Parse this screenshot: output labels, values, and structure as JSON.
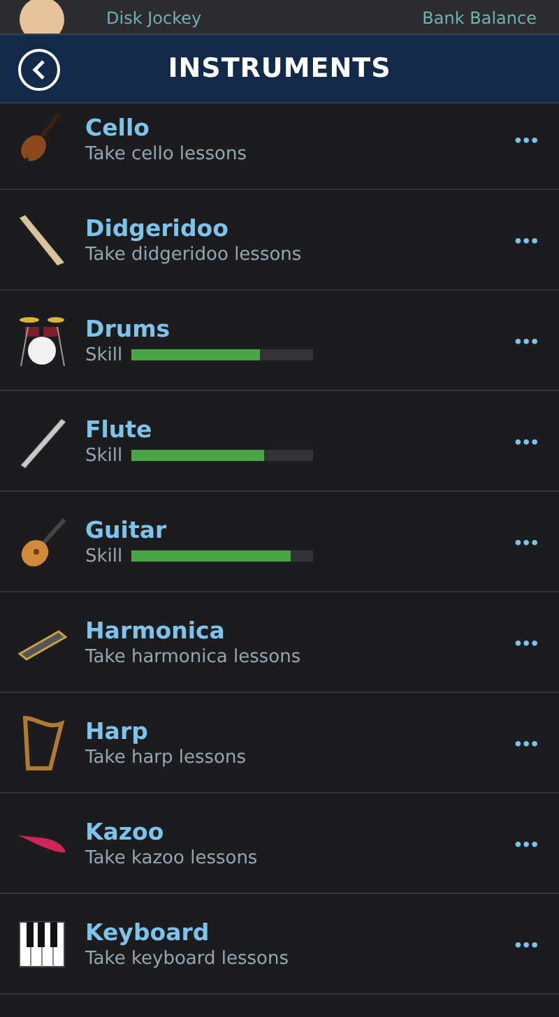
{
  "top_bar": {
    "job": "Disk Jockey",
    "balance_label": "Bank Balance"
  },
  "header": {
    "title": "INSTRUMENTS"
  },
  "instruments": [
    {
      "name": "Cello",
      "kind": "lessons",
      "subtitle": "Take cello lessons",
      "more": "•••"
    },
    {
      "name": "Didgeridoo",
      "kind": "lessons",
      "subtitle": "Take didgeridoo lessons",
      "more": "•••"
    },
    {
      "name": "Drums",
      "kind": "skill",
      "subtitle": "Skill",
      "level": 0.71,
      "more": "•••"
    },
    {
      "name": "Flute",
      "kind": "skill",
      "subtitle": "Skill",
      "level": 0.73,
      "more": "•••"
    },
    {
      "name": "Guitar",
      "kind": "skill",
      "subtitle": "Skill",
      "level": 0.88,
      "more": "•••"
    },
    {
      "name": "Harmonica",
      "kind": "lessons",
      "subtitle": "Take harmonica lessons",
      "more": "•••"
    },
    {
      "name": "Harp",
      "kind": "lessons",
      "subtitle": "Take harp lessons",
      "more": "•••"
    },
    {
      "name": "Kazoo",
      "kind": "lessons",
      "subtitle": "Take kazoo lessons",
      "more": "•••"
    },
    {
      "name": "Keyboard",
      "kind": "lessons",
      "subtitle": "Take keyboard lessons",
      "more": "•••"
    }
  ]
}
